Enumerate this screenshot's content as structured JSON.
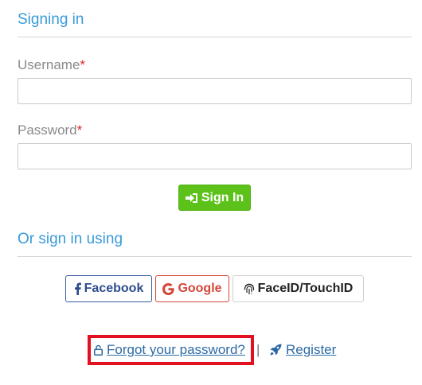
{
  "signing_in": {
    "title": "Signing in",
    "username_label": "Username",
    "password_label": "Password",
    "required_marker": "*",
    "username_value": "",
    "password_value": "",
    "submit_label": "Sign In"
  },
  "alt_signin": {
    "title": "Or sign in using",
    "facebook_label": "Facebook",
    "google_label": "Google",
    "faceid_label": "FaceID/TouchID"
  },
  "footer": {
    "forgot_label": "Forgot your password?",
    "separator": "|",
    "register_label": "Register"
  },
  "colors": {
    "accent": "#3a9ad9",
    "success": "#5cc21a",
    "facebook": "#2e4d8f",
    "google": "#d44638",
    "highlight": "#e3101f",
    "link": "#2c6aa5"
  },
  "icons": {
    "signin": "sign-in-icon",
    "facebook": "facebook-icon",
    "google": "google-icon",
    "faceid": "fingerprint-icon",
    "forgot": "unlock-icon",
    "register": "rocket-icon"
  }
}
